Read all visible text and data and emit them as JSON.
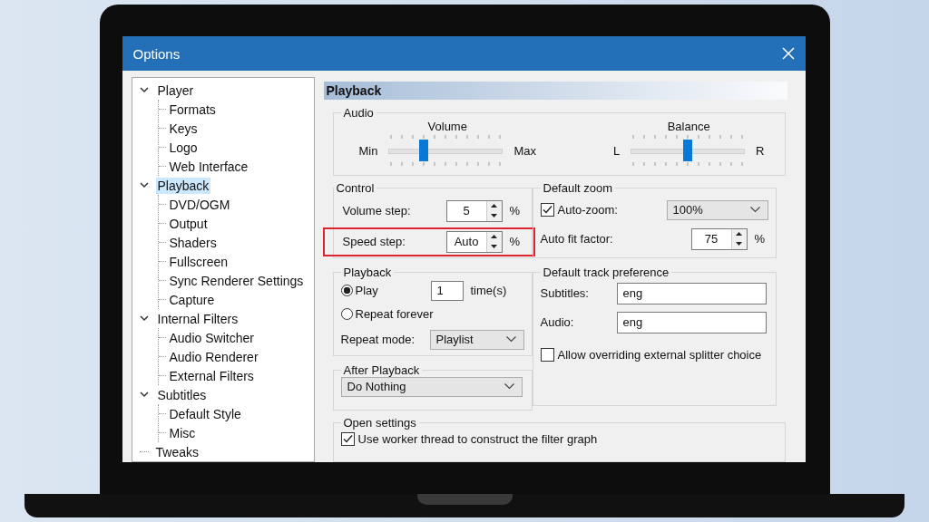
{
  "window": {
    "title": "Options"
  },
  "tree": [
    {
      "label": "Player",
      "expanded": true,
      "selected": false,
      "children": [
        {
          "label": "Formats",
          "selected": false
        },
        {
          "label": "Keys",
          "selected": false
        },
        {
          "label": "Logo",
          "selected": false
        },
        {
          "label": "Web Interface",
          "selected": false
        }
      ]
    },
    {
      "label": "Playback",
      "expanded": true,
      "selected": true,
      "children": [
        {
          "label": "DVD/OGM",
          "selected": false
        },
        {
          "label": "Output",
          "selected": false
        },
        {
          "label": "Shaders",
          "selected": false
        },
        {
          "label": "Fullscreen",
          "selected": false
        },
        {
          "label": "Sync Renderer Settings",
          "selected": false
        },
        {
          "label": "Capture",
          "selected": false
        }
      ]
    },
    {
      "label": "Internal Filters",
      "expanded": true,
      "selected": false,
      "children": [
        {
          "label": "Audio Switcher",
          "selected": false
        },
        {
          "label": "Audio Renderer",
          "selected": false
        },
        {
          "label": "External Filters",
          "selected": false
        }
      ]
    },
    {
      "label": "Subtitles",
      "expanded": true,
      "selected": false,
      "children": [
        {
          "label": "Default Style",
          "selected": false
        },
        {
          "label": "Misc",
          "selected": false
        }
      ]
    },
    {
      "label": "Tweaks",
      "selected": false
    }
  ],
  "page": {
    "title": "Playback",
    "audio": {
      "title": "Audio",
      "sliders": [
        {
          "label": "Volume",
          "min_label": "Min",
          "max_label": "Max",
          "level": 0.3
        },
        {
          "label": "Balance",
          "min_label": "L",
          "max_label": "R",
          "level": 0.5
        }
      ]
    },
    "control": {
      "title": "Control",
      "rows": [
        {
          "label": "Volume step:",
          "value": "5",
          "unit": "%",
          "highlighted": false
        },
        {
          "label": "Speed step:",
          "value": "Auto",
          "unit": "%",
          "highlighted": true
        }
      ]
    },
    "default_zoom": {
      "title": "Default zoom",
      "auto_zoom": {
        "label": "Auto-zoom:",
        "checked": true,
        "value": "100%"
      },
      "auto_fit": {
        "label": "Auto fit factor:",
        "value": "75",
        "unit": "%"
      }
    },
    "playback": {
      "title": "Playback",
      "options": [
        {
          "label": "Play",
          "selected": true
        },
        {
          "label": "Repeat forever",
          "selected": false
        }
      ],
      "times": {
        "value": "1",
        "unit": "time(s)"
      },
      "repeat_mode": {
        "label": "Repeat mode:",
        "value": "Playlist"
      }
    },
    "after_playback": {
      "title": "After Playback",
      "value": "Do Nothing"
    },
    "track_preference": {
      "title": "Default track preference",
      "fields": [
        {
          "label": "Subtitles:",
          "value": "eng"
        },
        {
          "label": "Audio:",
          "value": "eng"
        }
      ],
      "allow_override": {
        "label": "Allow overriding external splitter choice",
        "checked": false
      }
    },
    "open_settings": {
      "title": "Open settings",
      "worker_thread": {
        "label": "Use worker thread to construct the filter graph",
        "checked": true
      }
    }
  }
}
